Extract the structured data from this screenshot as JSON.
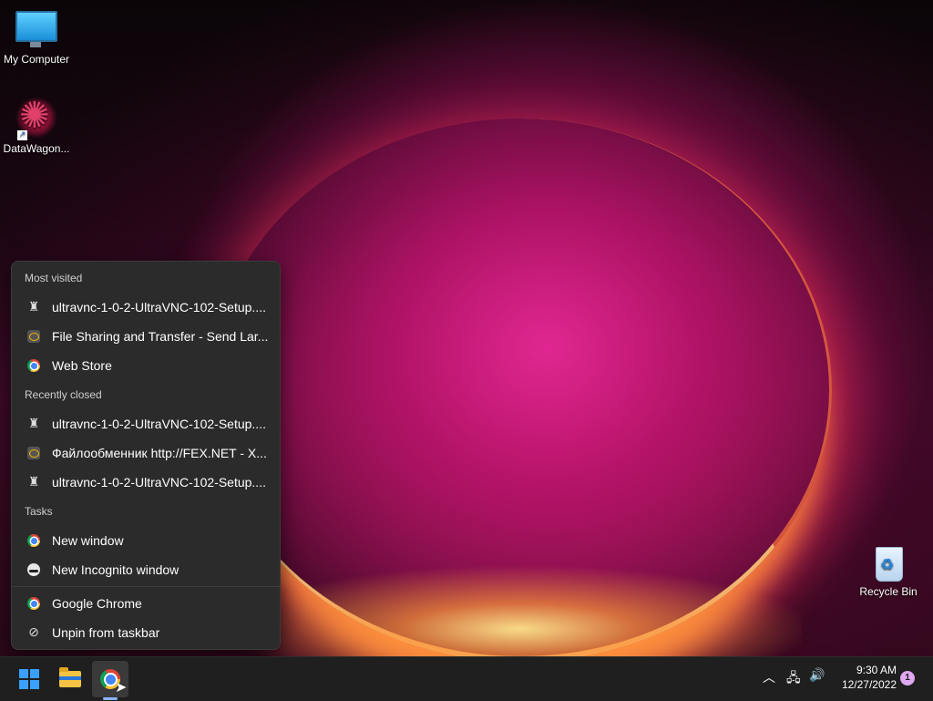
{
  "desktop": {
    "icons": [
      {
        "label": "My Computer"
      },
      {
        "label": "DataWagon..."
      },
      {
        "label": "Recycle Bin"
      }
    ]
  },
  "jumplist": {
    "most_visited_title": "Most visited",
    "most_visited": [
      {
        "label": "ultravnc-1-0-2-UltraVNC-102-Setup....",
        "icon": "ultravnc-icon"
      },
      {
        "label": "File Sharing and Transfer - Send Lar...",
        "icon": "fex-icon"
      },
      {
        "label": "Web Store",
        "icon": "chrome-icon"
      }
    ],
    "recently_closed_title": "Recently closed",
    "recently_closed": [
      {
        "label": "ultravnc-1-0-2-UltraVNC-102-Setup....",
        "icon": "ultravnc-icon"
      },
      {
        "label": "Файлообменник http://FEX.NET - X...",
        "icon": "fex-icon"
      },
      {
        "label": "ultravnc-1-0-2-UltraVNC-102-Setup....",
        "icon": "ultravnc-icon"
      }
    ],
    "tasks_title": "Tasks",
    "tasks": [
      {
        "label": "New window",
        "icon": "chrome-icon"
      },
      {
        "label": "New Incognito window",
        "icon": "incognito-icon"
      }
    ],
    "app": {
      "label": "Google Chrome",
      "icon": "chrome-icon"
    },
    "unpin": {
      "label": "Unpin from taskbar",
      "icon": "unpin-icon"
    }
  },
  "taskbar": {
    "apps": [
      {
        "name": "start",
        "icon": "windows-logo-icon"
      },
      {
        "name": "file-explorer",
        "icon": "folder-icon"
      },
      {
        "name": "google-chrome",
        "icon": "chrome-icon",
        "active": true
      }
    ],
    "tray": {
      "time": "9:30 AM",
      "date": "12/27/2022",
      "notification_count": "1"
    }
  },
  "colors": {
    "menu_bg": "#2b2b2b",
    "taskbar_bg": "#1f1f1f",
    "accent": "#3aa0ff"
  }
}
